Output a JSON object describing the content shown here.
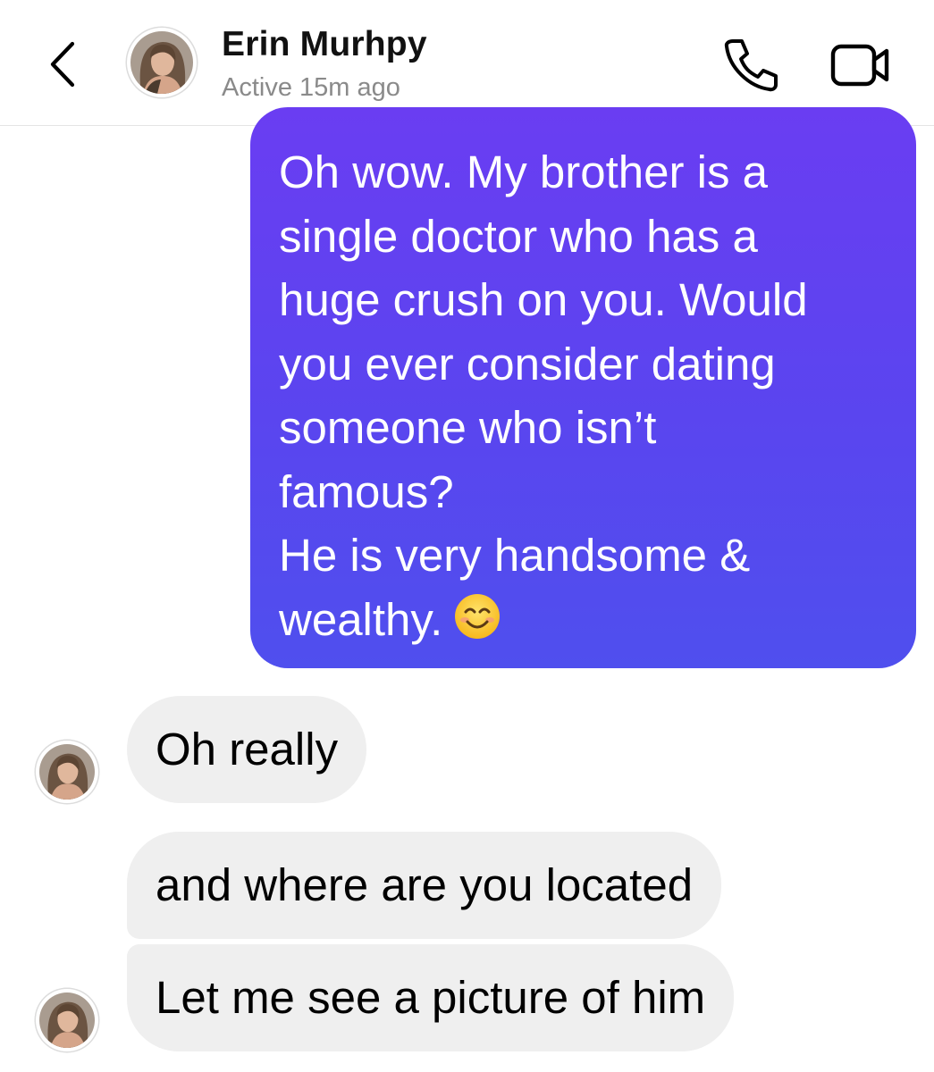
{
  "header": {
    "contact_name": "Erin Murhpy",
    "status": "Active 15m ago",
    "icons": [
      "chevron-left-icon",
      "avatar",
      "phone-icon",
      "video-camera-icon"
    ]
  },
  "thread": {
    "sent": [
      {
        "lines": [
          "Oh wow. My brother is a",
          "single doctor who has a",
          "huge crush on you. Would",
          "you ever consider dating",
          "someone who isn’t",
          "famous?",
          "He is very handsome &",
          "wealthy."
        ],
        "emoji": "smiling-face-icon"
      }
    ],
    "received": [
      {
        "text": "Oh really"
      },
      {
        "text": "and where are you located"
      },
      {
        "text": "Let me see a picture of him"
      }
    ]
  },
  "colors": {
    "sent_bubble_top": "#6a3df2",
    "sent_bubble_bottom": "#4f4fee",
    "received_bubble": "#efefef",
    "status_text": "#8a8a8a"
  }
}
